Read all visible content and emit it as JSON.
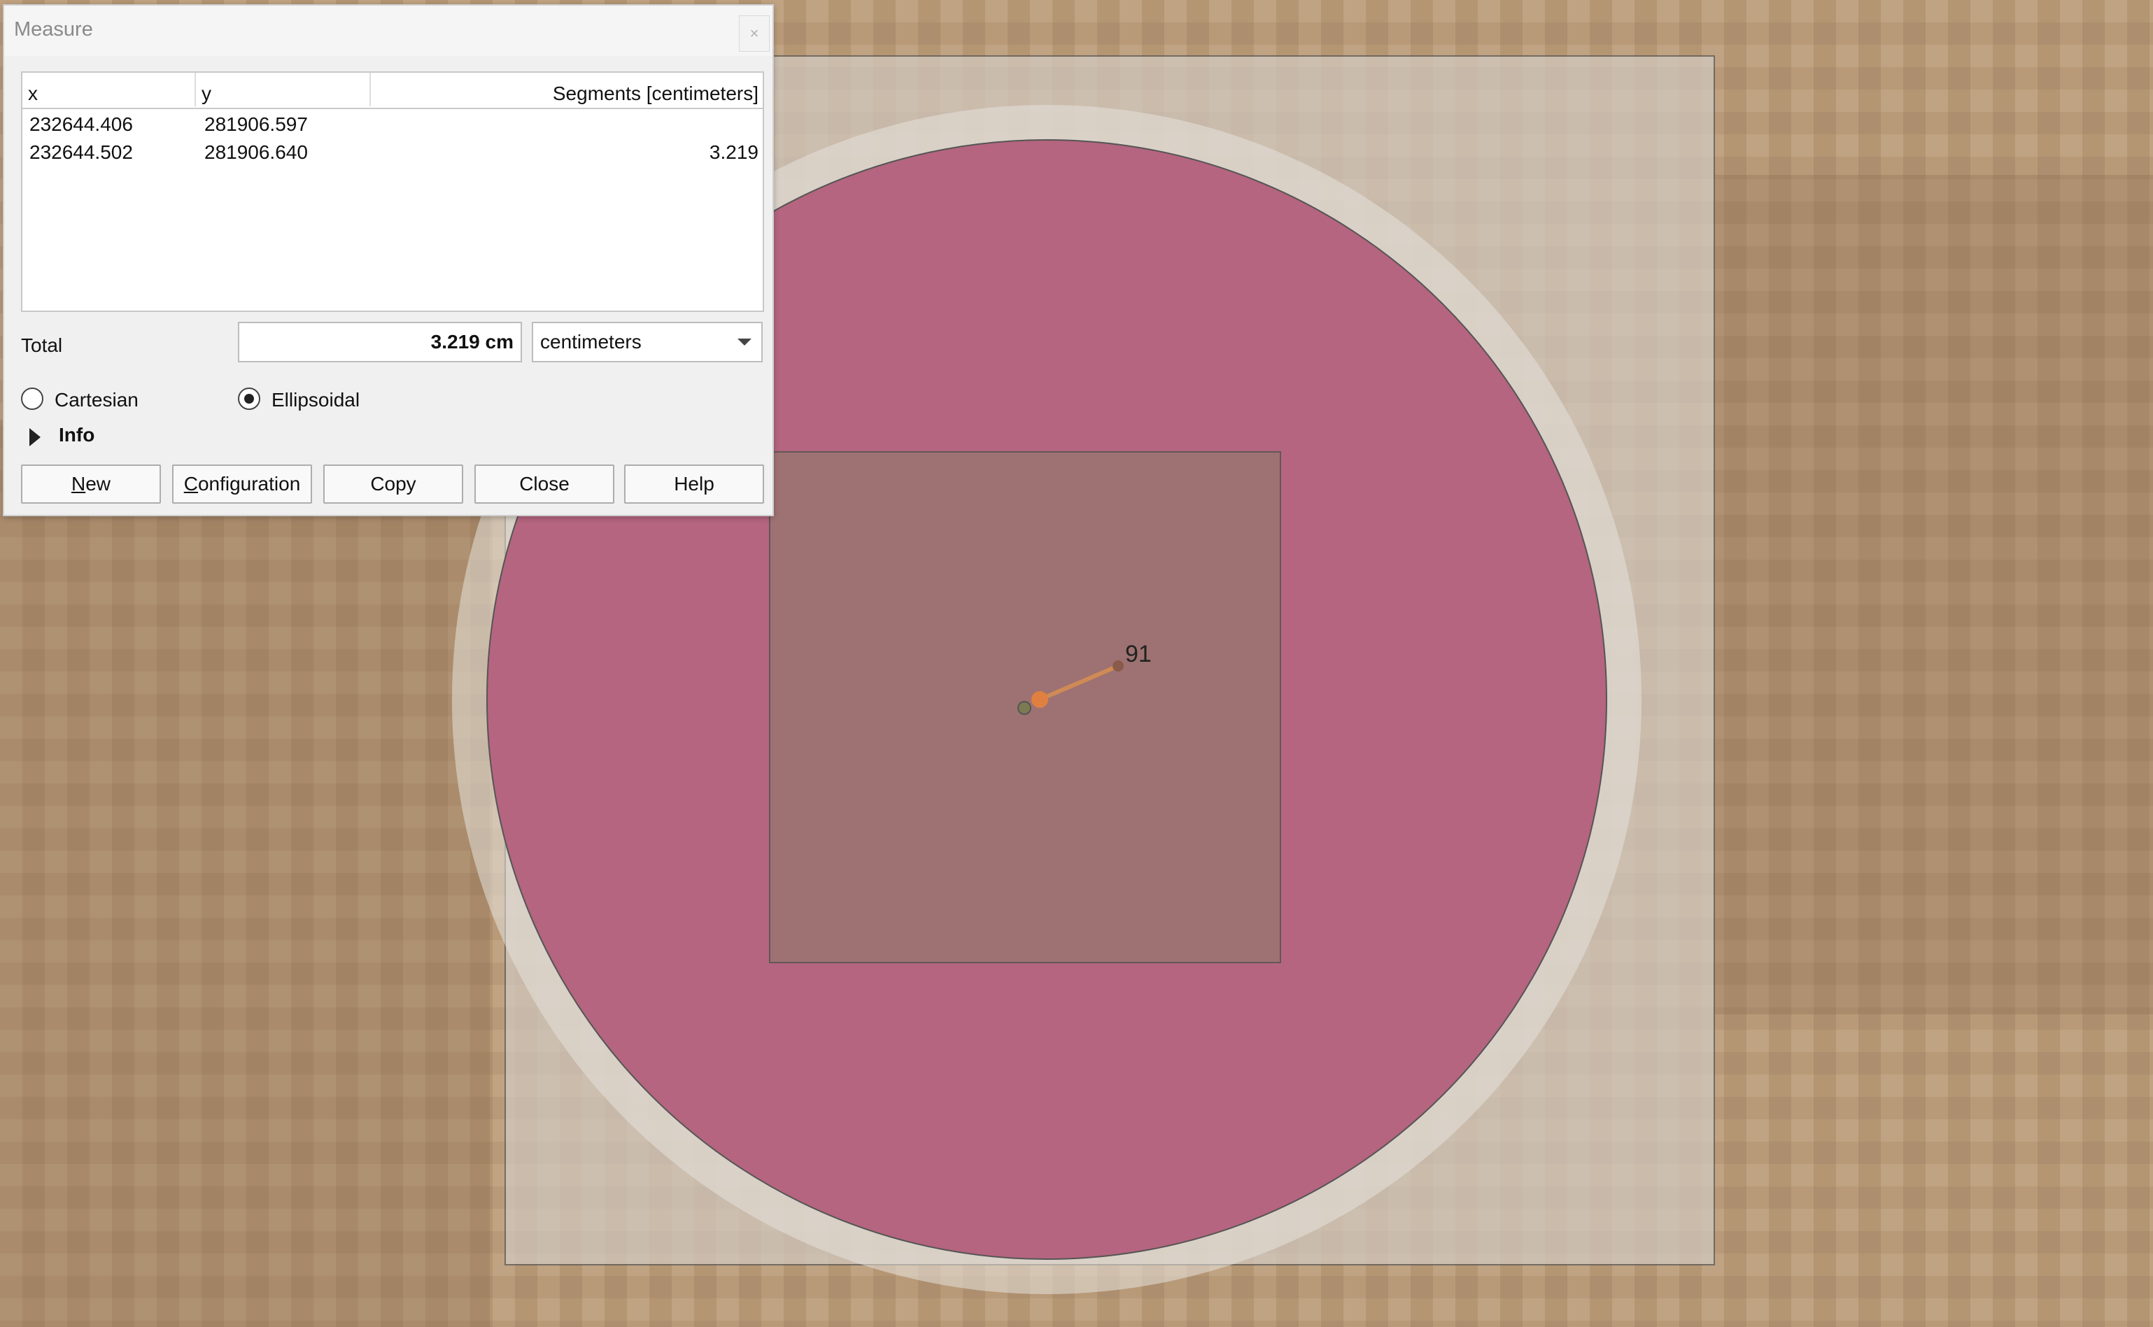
{
  "dialog": {
    "title": "Measure",
    "close_glyph": "×",
    "table": {
      "headers": {
        "x": "x",
        "y": "y",
        "segments": "Segments [centimeters]"
      },
      "rows": [
        {
          "x": "232644.406",
          "y": "281906.597",
          "segment": ""
        },
        {
          "x": "232644.502",
          "y": "281906.640",
          "segment": "3.219"
        }
      ]
    },
    "total_label": "Total",
    "total_value": "3.219 cm",
    "unit_selected": "centimeters",
    "radio_cartesian": "Cartesian",
    "radio_ellipsoidal": "Ellipsoidal",
    "selected_mode": "Ellipsoidal",
    "info_label": "Info",
    "buttons": {
      "new_mnemonic": "N",
      "new_rest": "ew",
      "configuration_mnemonic": "C",
      "configuration_rest": "onfiguration",
      "copy": "Copy",
      "close": "Close",
      "help": "Help"
    }
  },
  "map": {
    "measure_label": "91",
    "colors": {
      "raster_tan": "#b89a78",
      "buffer_pink": "#b5657f",
      "inner_square": "#9a7570",
      "extent_box": "#cfc7c0",
      "measure_line": "#d08a55"
    }
  }
}
